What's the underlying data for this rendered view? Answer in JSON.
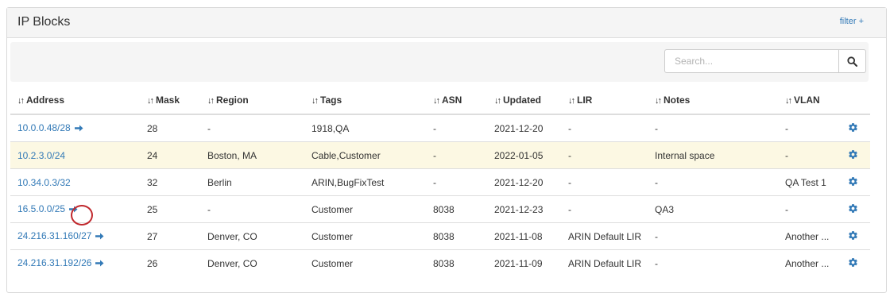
{
  "panel": {
    "title": "IP Blocks",
    "filter_label": "filter +"
  },
  "search": {
    "placeholder": "Search...",
    "icon": "search-icon"
  },
  "table": {
    "columns": [
      "Address",
      "Mask",
      "Region",
      "Tags",
      "ASN",
      "Updated",
      "LIR",
      "Notes",
      "VLAN"
    ],
    "rows": [
      {
        "address": "10.0.0.48/28",
        "has_arrow": true,
        "mask": "28",
        "region": "-",
        "tags": "1918,QA",
        "asn": "-",
        "updated": "2021-12-20",
        "lir": "-",
        "notes": "-",
        "vlan": "-",
        "highlight": false
      },
      {
        "address": "10.2.3.0/24",
        "has_arrow": false,
        "mask": "24",
        "region": "Boston, MA",
        "tags": "Cable,Customer",
        "asn": "-",
        "updated": "2022-01-05",
        "lir": "-",
        "notes": "Internal space",
        "vlan": "-",
        "highlight": true
      },
      {
        "address": "10.34.0.3/32",
        "has_arrow": false,
        "mask": "32",
        "region": "Berlin",
        "tags": "ARIN,BugFixTest",
        "asn": "-",
        "updated": "2021-12-20",
        "lir": "-",
        "notes": "-",
        "vlan": "QA Test 1",
        "highlight": false
      },
      {
        "address": "16.5.0.0/25",
        "has_arrow": true,
        "mask": "25",
        "region": "-",
        "tags": "Customer",
        "asn": "8038",
        "updated": "2021-12-23",
        "lir": "-",
        "notes": "QA3",
        "vlan": "-",
        "highlight": false
      },
      {
        "address": "24.216.31.160/27",
        "has_arrow": true,
        "mask": "27",
        "region": "Denver, CO",
        "tags": "Customer",
        "asn": "8038",
        "updated": "2021-11-08",
        "lir": "ARIN Default LIR",
        "notes": "-",
        "vlan": "Another ...",
        "highlight": false
      },
      {
        "address": "24.216.31.192/26",
        "has_arrow": true,
        "mask": "26",
        "region": "Denver, CO",
        "tags": "Customer",
        "asn": "8038",
        "updated": "2021-11-09",
        "lir": "ARIN Default LIR",
        "notes": "-",
        "vlan": "Another ...",
        "highlight": false
      }
    ]
  },
  "colors": {
    "link": "#337ab7",
    "highlight_row": "#fcf8e3",
    "annotation_circle": "#c0282d"
  }
}
